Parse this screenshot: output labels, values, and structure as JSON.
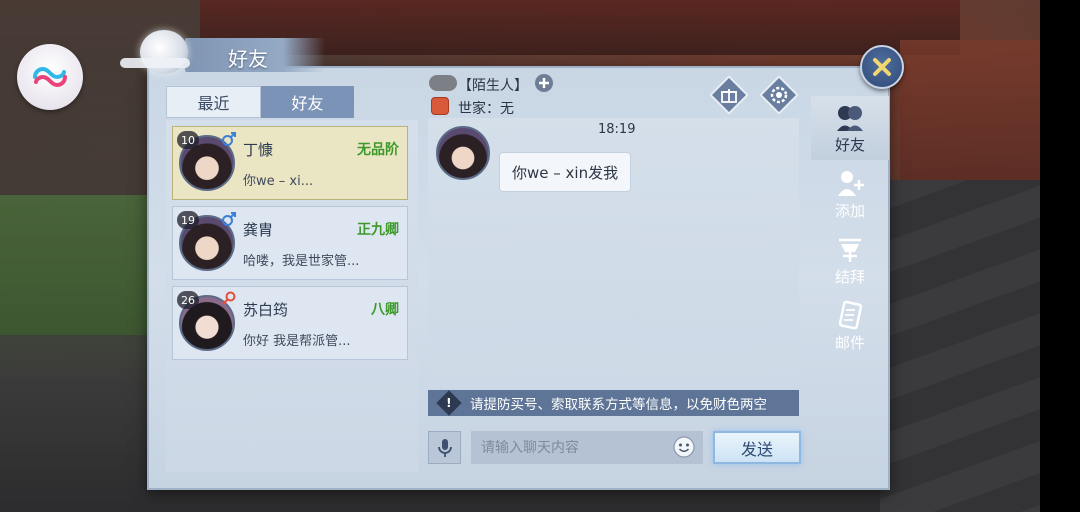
{
  "panel": {
    "title": "好友"
  },
  "tabs": [
    {
      "label": "最近"
    },
    {
      "label": "好友"
    }
  ],
  "friends": [
    {
      "level": "10",
      "name": "丁慷",
      "rank": "无品阶",
      "message": "你we – xi...",
      "gender": "male"
    },
    {
      "level": "19",
      "name": "龚胄",
      "rank": "正九卿",
      "message": "哈喽，我是世家管...",
      "gender": "male"
    },
    {
      "level": "26",
      "name": "苏白筠",
      "rank": "八卿",
      "message": "你好 我是帮派管...",
      "gender": "female"
    }
  ],
  "chat": {
    "name": "【陌生人】",
    "clan": "世家：无",
    "time": "18:19",
    "message": "你we – xin发我",
    "warning": "请提防买号、索取联系方式等信息，以免财色两空",
    "input_placeholder": "请输入聊天内容",
    "send_label": "发送"
  },
  "side_nav": [
    {
      "label": "好友",
      "icon": "friends-icon"
    },
    {
      "label": "添加",
      "icon": "add-friend-icon"
    },
    {
      "label": "结拜",
      "icon": "sworn-brother-icon"
    },
    {
      "label": "邮件",
      "icon": "mail-icon"
    }
  ],
  "colors": {
    "accent": "#7b93b6",
    "rank_green": "#3d9a2a",
    "warning_bar": "#5f7597",
    "selected_card": "#eae6c4"
  }
}
